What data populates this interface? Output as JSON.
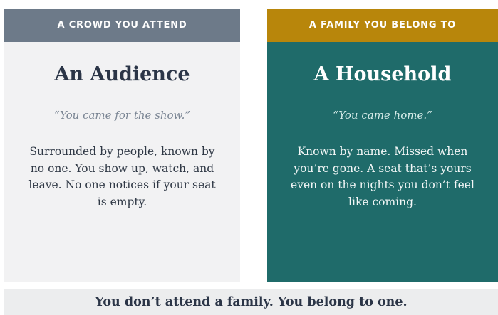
{
  "cards": [
    {
      "header": "A CROWD YOU ATTEND",
      "title": "An Audience",
      "quote": "“You came for the show.”",
      "body": "Surrounded by people, known by no one. You show up, watch, and leave. No one notices if your seat is empty."
    },
    {
      "header": "A FAMILY YOU BELONG TO",
      "title": "A Household",
      "quote": "“You came home.”",
      "body": "Known by name. Missed when you’re gone. A seat that’s yours even on the nights you don’t feel like coming."
    }
  ],
  "footer": {
    "text": "You don’t attend a family. You belong to one."
  },
  "colors": {
    "left_header": "#6d7a89",
    "left_background": "#f2f2f3",
    "right_header": "#b8860b",
    "right_background": "#1f6b6a",
    "footer_background": "#ecedee",
    "title_dark": "#2b3547"
  }
}
